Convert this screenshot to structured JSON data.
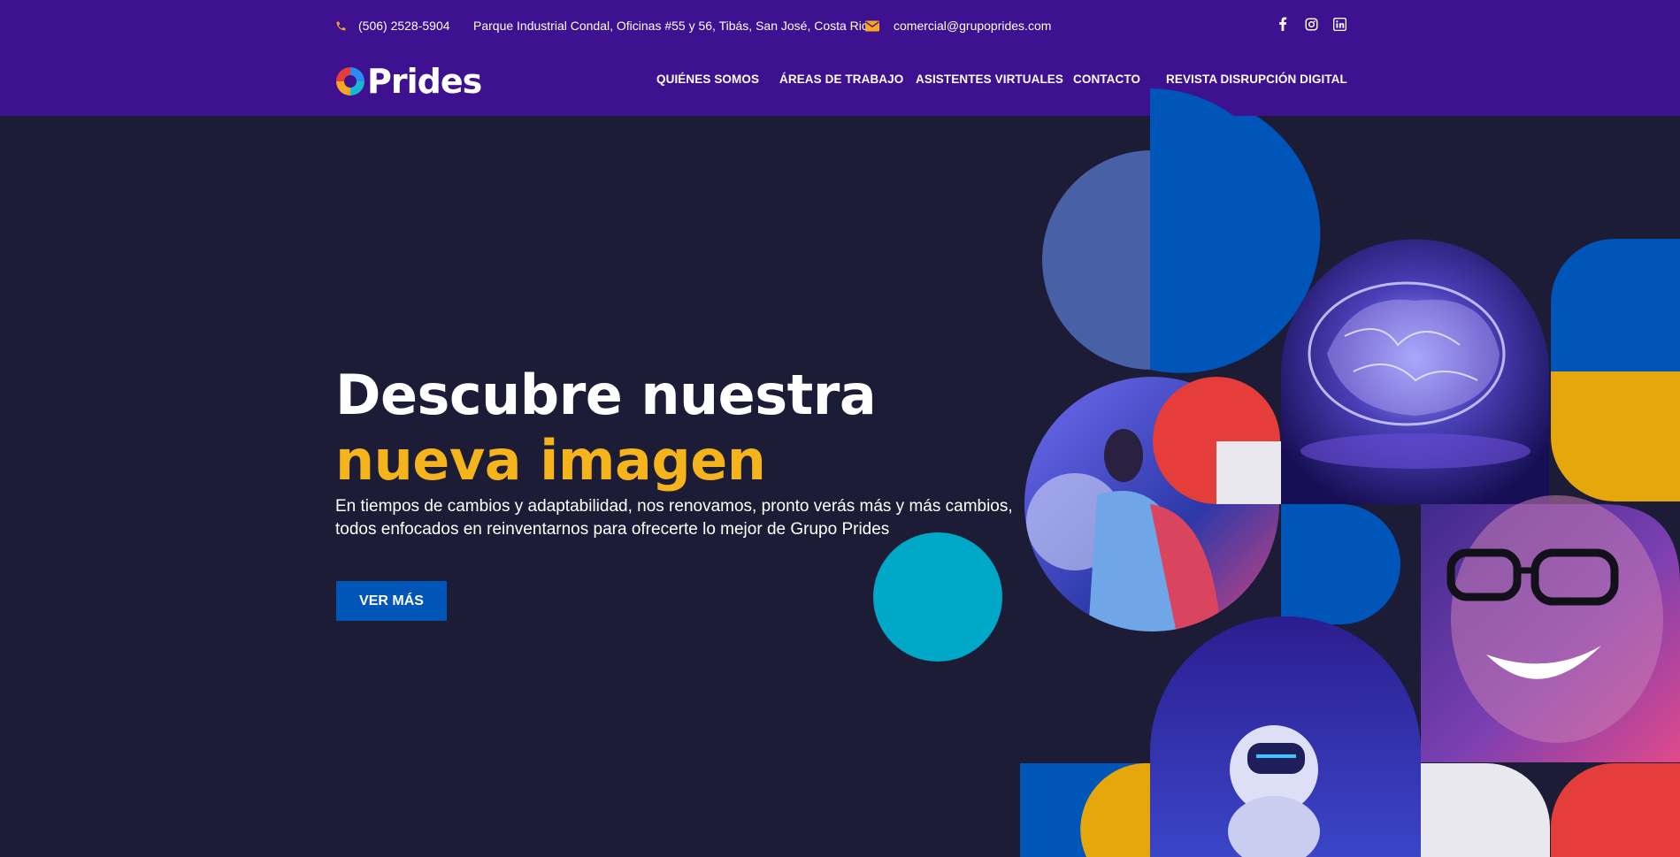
{
  "topbar": {
    "phone": "(506) 2528-5904",
    "address": "Parque Industrial Condal, Oficinas #55 y 56, Tibás, San José, Costa Rica",
    "email": "comercial@grupoprides.com",
    "social": [
      "facebook-icon",
      "instagram-icon",
      "linkedin-icon"
    ]
  },
  "logo": {
    "text": "Prides"
  },
  "nav": {
    "items": [
      {
        "label": "QUIÉNES SOMOS"
      },
      {
        "label": "ÁREAS DE TRABAJO"
      },
      {
        "label": "ASISTENTES VIRTUALES"
      },
      {
        "label": "CONTACTO"
      },
      {
        "label": "REVISTA DISRUPCIÓN DIGITAL"
      }
    ]
  },
  "hero": {
    "title_line1": "Descubre nuestra",
    "title_line2": "nueva imagen",
    "description": "En tiempos de cambios y adaptabilidad, nos renovamos, pronto verás más y más cambios, todos enfocados en reinventarnos para ofrecerte lo mejor de Grupo Prides",
    "cta_label": "VER MÁS"
  },
  "colors": {
    "header_bg": "#3d118f",
    "page_bg": "#1d1c37",
    "accent_yellow": "#f5b31c",
    "accent_orange": "#f5a623",
    "primary_blue": "#0055b8",
    "red": "#e53e3a",
    "teal": "#00a8c8",
    "gold": "#e5a70c"
  }
}
